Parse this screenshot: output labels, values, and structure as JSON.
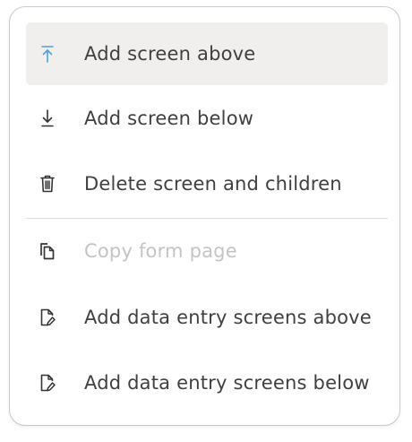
{
  "menu": {
    "items": [
      {
        "label": "Add screen above",
        "icon": "arrow-up-to-line-icon",
        "state": "hovered",
        "icon_color": "#4aa3d8"
      },
      {
        "label": "Add screen below",
        "icon": "arrow-down-to-line-icon",
        "state": "normal"
      },
      {
        "label": "Delete screen and children",
        "icon": "trash-icon",
        "state": "normal"
      },
      {
        "label": "Copy form page",
        "icon": "copy-pages-icon",
        "state": "disabled"
      },
      {
        "label": "Add data entry screens above",
        "icon": "file-edit-icon",
        "state": "normal"
      },
      {
        "label": "Add data entry screens below",
        "icon": "file-edit-icon",
        "state": "normal"
      }
    ]
  },
  "colors": {
    "text": "#404040",
    "disabled_text": "#c4c4c4",
    "hover_bg": "#f0efed",
    "accent": "#4aa3d8",
    "border": "#c9c9c9"
  }
}
